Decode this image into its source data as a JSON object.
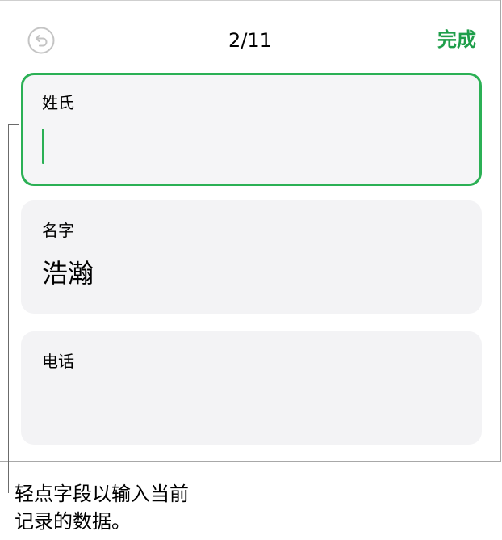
{
  "header": {
    "undo_icon": "undo-icon",
    "record_counter": "2/11",
    "done_label": "完成"
  },
  "fields": [
    {
      "label": "姓氏",
      "value": "",
      "focused": true
    },
    {
      "label": "名字",
      "value": "浩瀚",
      "focused": false
    },
    {
      "label": "电话",
      "value": "",
      "focused": false
    }
  ],
  "callout": {
    "line1": "轻点字段以输入当前",
    "line2": "记录的数据。"
  },
  "colors": {
    "accent": "#1e9e4a",
    "focus_border": "#2bb055",
    "card_background": "#f3f3f5"
  }
}
